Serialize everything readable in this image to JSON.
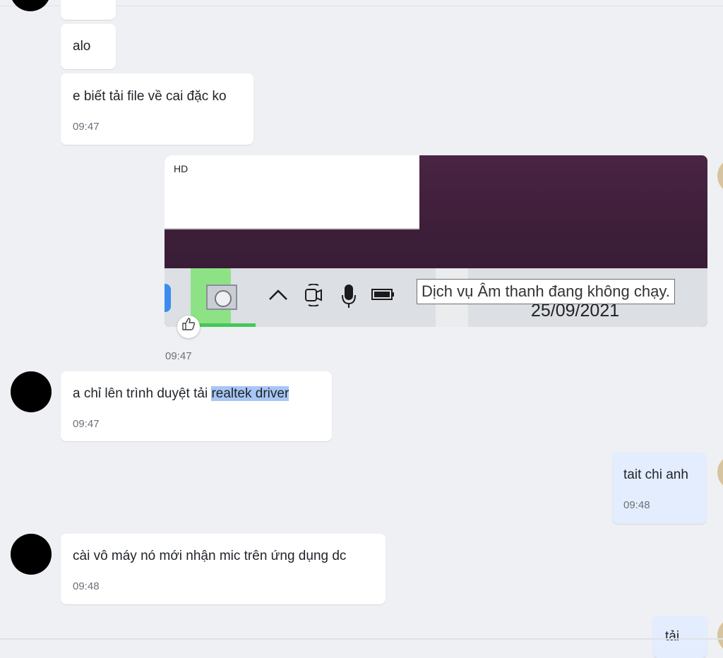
{
  "messages": [
    {
      "text": "alo"
    },
    {
      "text": "e biết tải file về cai đặc ko",
      "time": "09:47"
    },
    {
      "text_prefix": "a chỉ  lên trình duyệt tải ",
      "text_highlight": "realtek driver",
      "time": "09:47"
    },
    {
      "text": "tait chi anh",
      "time": "09:48"
    },
    {
      "text": "cài vô máy nó mới nhận mic trên ứng dụng dc",
      "time": "09:48"
    },
    {
      "text": "tải"
    }
  ],
  "photo": {
    "hd_label": "HD",
    "tooltip": "Dịch vụ Âm thanh đang không chạy.",
    "date": "25/09/2021",
    "time": "09:47",
    "caret_icon": "^",
    "like_icon": "👍"
  },
  "colors": {
    "incoming_bubble": "#ffffff",
    "outgoing_bubble": "#e3edfd",
    "highlight": "#a7c6f3"
  }
}
